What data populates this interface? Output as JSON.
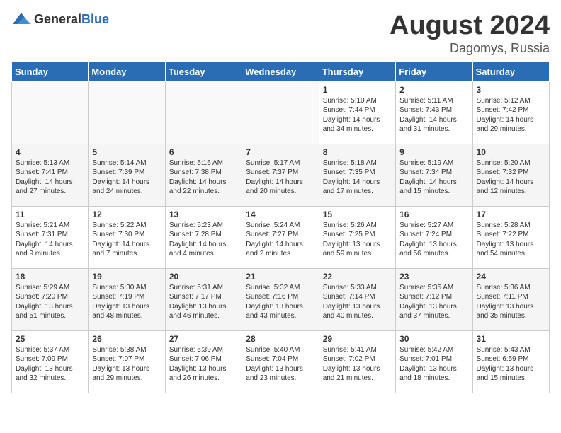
{
  "header": {
    "logo_general": "General",
    "logo_blue": "Blue",
    "title": "August 2024",
    "location": "Dagomys, Russia"
  },
  "days_of_week": [
    "Sunday",
    "Monday",
    "Tuesday",
    "Wednesday",
    "Thursday",
    "Friday",
    "Saturday"
  ],
  "weeks": [
    [
      {
        "day": "",
        "info": ""
      },
      {
        "day": "",
        "info": ""
      },
      {
        "day": "",
        "info": ""
      },
      {
        "day": "",
        "info": ""
      },
      {
        "day": "1",
        "info": "Sunrise: 5:10 AM\nSunset: 7:44 PM\nDaylight: 14 hours\nand 34 minutes."
      },
      {
        "day": "2",
        "info": "Sunrise: 5:11 AM\nSunset: 7:43 PM\nDaylight: 14 hours\nand 31 minutes."
      },
      {
        "day": "3",
        "info": "Sunrise: 5:12 AM\nSunset: 7:42 PM\nDaylight: 14 hours\nand 29 minutes."
      }
    ],
    [
      {
        "day": "4",
        "info": "Sunrise: 5:13 AM\nSunset: 7:41 PM\nDaylight: 14 hours\nand 27 minutes."
      },
      {
        "day": "5",
        "info": "Sunrise: 5:14 AM\nSunset: 7:39 PM\nDaylight: 14 hours\nand 24 minutes."
      },
      {
        "day": "6",
        "info": "Sunrise: 5:16 AM\nSunset: 7:38 PM\nDaylight: 14 hours\nand 22 minutes."
      },
      {
        "day": "7",
        "info": "Sunrise: 5:17 AM\nSunset: 7:37 PM\nDaylight: 14 hours\nand 20 minutes."
      },
      {
        "day": "8",
        "info": "Sunrise: 5:18 AM\nSunset: 7:35 PM\nDaylight: 14 hours\nand 17 minutes."
      },
      {
        "day": "9",
        "info": "Sunrise: 5:19 AM\nSunset: 7:34 PM\nDaylight: 14 hours\nand 15 minutes."
      },
      {
        "day": "10",
        "info": "Sunrise: 5:20 AM\nSunset: 7:32 PM\nDaylight: 14 hours\nand 12 minutes."
      }
    ],
    [
      {
        "day": "11",
        "info": "Sunrise: 5:21 AM\nSunset: 7:31 PM\nDaylight: 14 hours\nand 9 minutes."
      },
      {
        "day": "12",
        "info": "Sunrise: 5:22 AM\nSunset: 7:30 PM\nDaylight: 14 hours\nand 7 minutes."
      },
      {
        "day": "13",
        "info": "Sunrise: 5:23 AM\nSunset: 7:28 PM\nDaylight: 14 hours\nand 4 minutes."
      },
      {
        "day": "14",
        "info": "Sunrise: 5:24 AM\nSunset: 7:27 PM\nDaylight: 14 hours\nand 2 minutes."
      },
      {
        "day": "15",
        "info": "Sunrise: 5:26 AM\nSunset: 7:25 PM\nDaylight: 13 hours\nand 59 minutes."
      },
      {
        "day": "16",
        "info": "Sunrise: 5:27 AM\nSunset: 7:24 PM\nDaylight: 13 hours\nand 56 minutes."
      },
      {
        "day": "17",
        "info": "Sunrise: 5:28 AM\nSunset: 7:22 PM\nDaylight: 13 hours\nand 54 minutes."
      }
    ],
    [
      {
        "day": "18",
        "info": "Sunrise: 5:29 AM\nSunset: 7:20 PM\nDaylight: 13 hours\nand 51 minutes."
      },
      {
        "day": "19",
        "info": "Sunrise: 5:30 AM\nSunset: 7:19 PM\nDaylight: 13 hours\nand 48 minutes."
      },
      {
        "day": "20",
        "info": "Sunrise: 5:31 AM\nSunset: 7:17 PM\nDaylight: 13 hours\nand 46 minutes."
      },
      {
        "day": "21",
        "info": "Sunrise: 5:32 AM\nSunset: 7:16 PM\nDaylight: 13 hours\nand 43 minutes."
      },
      {
        "day": "22",
        "info": "Sunrise: 5:33 AM\nSunset: 7:14 PM\nDaylight: 13 hours\nand 40 minutes."
      },
      {
        "day": "23",
        "info": "Sunrise: 5:35 AM\nSunset: 7:12 PM\nDaylight: 13 hours\nand 37 minutes."
      },
      {
        "day": "24",
        "info": "Sunrise: 5:36 AM\nSunset: 7:11 PM\nDaylight: 13 hours\nand 35 minutes."
      }
    ],
    [
      {
        "day": "25",
        "info": "Sunrise: 5:37 AM\nSunset: 7:09 PM\nDaylight: 13 hours\nand 32 minutes."
      },
      {
        "day": "26",
        "info": "Sunrise: 5:38 AM\nSunset: 7:07 PM\nDaylight: 13 hours\nand 29 minutes."
      },
      {
        "day": "27",
        "info": "Sunrise: 5:39 AM\nSunset: 7:06 PM\nDaylight: 13 hours\nand 26 minutes."
      },
      {
        "day": "28",
        "info": "Sunrise: 5:40 AM\nSunset: 7:04 PM\nDaylight: 13 hours\nand 23 minutes."
      },
      {
        "day": "29",
        "info": "Sunrise: 5:41 AM\nSunset: 7:02 PM\nDaylight: 13 hours\nand 21 minutes."
      },
      {
        "day": "30",
        "info": "Sunrise: 5:42 AM\nSunset: 7:01 PM\nDaylight: 13 hours\nand 18 minutes."
      },
      {
        "day": "31",
        "info": "Sunrise: 5:43 AM\nSunset: 6:59 PM\nDaylight: 13 hours\nand 15 minutes."
      }
    ]
  ]
}
